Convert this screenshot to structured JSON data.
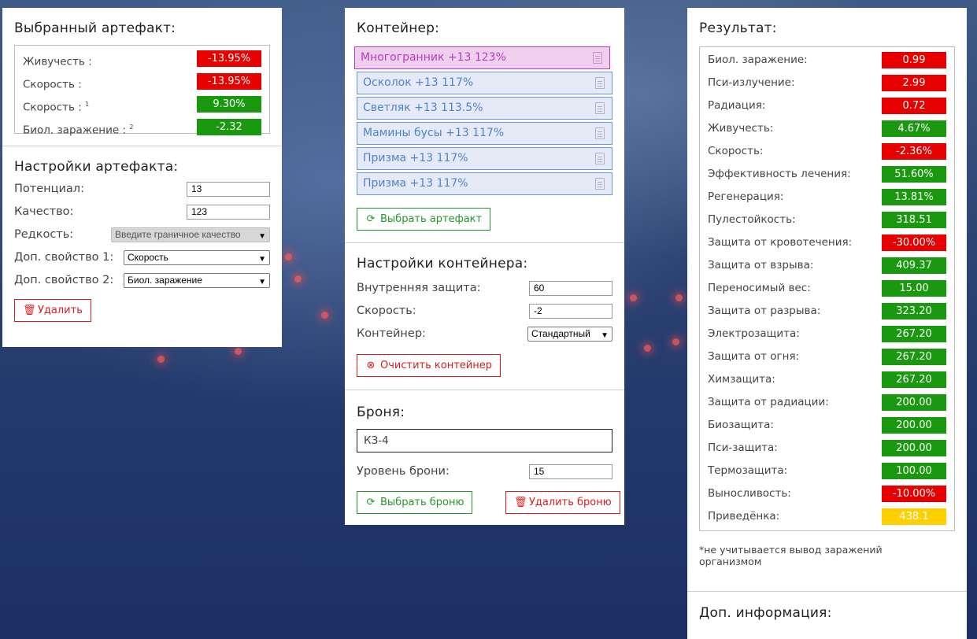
{
  "artifact": {
    "title": "Выбранный артефакт:",
    "stats": [
      {
        "label": "Живучесть :",
        "sup": "",
        "value": "-13.95%",
        "color": "red"
      },
      {
        "label": "Скорость :",
        "sup": "",
        "value": "-13.95%",
        "color": "red"
      },
      {
        "label": "Скорость :",
        "sup": "1",
        "value": "9.30%",
        "color": "green"
      },
      {
        "label": "Биол. заражение :",
        "sup": "2",
        "value": "-2.32",
        "color": "green"
      }
    ]
  },
  "artifact_settings": {
    "title": "Настройки артефакта:",
    "potential_label": "Потенциал:",
    "potential_value": "13",
    "quality_label": "Качество:",
    "quality_value": "123",
    "rarity_label": "Редкость:",
    "rarity_value": "Введите граничное качество",
    "extra1_label": "Доп. свойство 1:",
    "extra1_value": "Скорость",
    "extra2_label": "Доп. свойство 2:",
    "extra2_value": "Биол. заражение",
    "delete_label": "Удалить"
  },
  "container": {
    "title": "Контейнер:",
    "items": [
      {
        "label": "Многогранник +13 123%",
        "selected": true
      },
      {
        "label": "Осколок +13 117%",
        "selected": false
      },
      {
        "label": "Светляк +13 113.5%",
        "selected": false
      },
      {
        "label": "Мамины бусы +13 117%",
        "selected": false
      },
      {
        "label": "Призма +13 117%",
        "selected": false
      },
      {
        "label": "Призма +13 117%",
        "selected": false
      }
    ],
    "choose_label": "Выбрать артефакт"
  },
  "container_settings": {
    "title": "Настройки контейнера:",
    "inner_label": "Внутренняя защита:",
    "inner_value": "60",
    "speed_label": "Скорость:",
    "speed_value": "-2",
    "type_label": "Контейнер:",
    "type_value": "Стандартный",
    "clear_label": "Очистить контейнер"
  },
  "armor": {
    "title": "Броня:",
    "name": "КЗ-4",
    "level_label": "Уровень брони:",
    "level_value": "15",
    "choose_label": "Выбрать броню",
    "delete_label": "Удалить броню"
  },
  "result": {
    "title": "Результат:",
    "rows": [
      {
        "label": "Биол. заражение:",
        "value": "0.99",
        "color": "red"
      },
      {
        "label": "Пси-излучение:",
        "value": "2.99",
        "color": "red"
      },
      {
        "label": "Радиация:",
        "value": "0.72",
        "color": "red"
      },
      {
        "label": "Живучесть:",
        "value": "4.67%",
        "color": "green"
      },
      {
        "label": "Скорость:",
        "value": "-2.36%",
        "color": "red"
      },
      {
        "label": "Эффективность лечения:",
        "value": "51.60%",
        "color": "green"
      },
      {
        "label": "Регенерация:",
        "value": "13.81%",
        "color": "green"
      },
      {
        "label": "Пулестойкость:",
        "value": "318.51",
        "color": "green"
      },
      {
        "label": "Защита от кровотечения:",
        "value": "-30.00%",
        "color": "red"
      },
      {
        "label": "Защита от взрыва:",
        "value": "409.37",
        "color": "green"
      },
      {
        "label": "Переносимый вес:",
        "value": "15.00",
        "color": "green"
      },
      {
        "label": "Защита от разрыва:",
        "value": "323.20",
        "color": "green"
      },
      {
        "label": "Электрозащита:",
        "value": "267.20",
        "color": "green"
      },
      {
        "label": "Защита от огня:",
        "value": "267.20",
        "color": "green"
      },
      {
        "label": "Химзащита:",
        "value": "267.20",
        "color": "green"
      },
      {
        "label": "Защита от радиации:",
        "value": "200.00",
        "color": "green"
      },
      {
        "label": "Биозащита:",
        "value": "200.00",
        "color": "green"
      },
      {
        "label": "Пси-защита:",
        "value": "200.00",
        "color": "green"
      },
      {
        "label": "Термозащита:",
        "value": "100.00",
        "color": "green"
      },
      {
        "label": "Выносливость:",
        "value": "-10.00%",
        "color": "red"
      },
      {
        "label": "Приведёнка:",
        "value": "438.1",
        "color": "yellow"
      }
    ],
    "note": "*не учитывается вывод заражений организмом",
    "extra_title": "Доп. информация:"
  },
  "colors": {
    "red": "#e60000",
    "green": "#1a9910",
    "yellow": "#ffd000",
    "button_green": "#23982b",
    "button_red": "#d71d1d",
    "selected_item": "#b53dbf",
    "item": "#4a85d2"
  },
  "icons": {
    "refresh": "refresh-icon",
    "trash": "trash-icon",
    "clear": "x-circle-icon",
    "document": "document-icon",
    "dropdown": "chevron-down-icon"
  }
}
